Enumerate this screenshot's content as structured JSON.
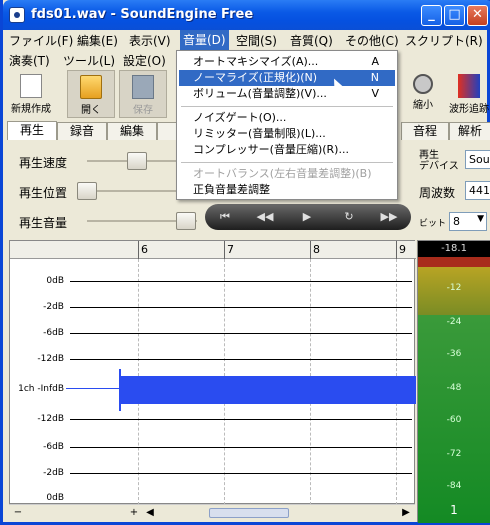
{
  "window": {
    "title": "fds01.wav - SoundEngine Free",
    "minimize_label": "_",
    "maximize_label": "□",
    "close_label": "✕"
  },
  "menubar": {
    "row1": [
      "ファイル(F)",
      "編集(E)",
      "表示(V)",
      "音量(D)",
      "空間(S)",
      "音質(Q)",
      "その他(C)",
      "スクリプト(R)"
    ],
    "row2": [
      "演奏(T)",
      "ツール(L)",
      "設定(O)"
    ],
    "open_menu": "音量(D)"
  },
  "toolbar": {
    "new": "新規作成",
    "open": "開く",
    "save": "保存",
    "reduce": "縮小",
    "wave_tracking": "波形追跡"
  },
  "tabs": [
    "再生",
    "録音",
    "編集",
    "音程",
    "解析"
  ],
  "controls": {
    "speed_label": "再生速度",
    "position_label": "再生位置",
    "volume_label": "再生音量",
    "device_label": "再生\nデバイス",
    "device_value": "Sou",
    "freq_label": "周波数",
    "freq_value": "441",
    "bit_label": "ビット",
    "bit_value": "8",
    "speed_level": 0.45,
    "position_level": 0.0,
    "volume_level": 0.9
  },
  "transport": {
    "rewind_icon": "skip-back-icon",
    "back_icon": "rewind-icon",
    "play_icon": "play-icon",
    "loop_icon": "loop-icon",
    "forward_icon": "fast-forward-icon"
  },
  "waveform": {
    "ruler": [
      "6",
      "7",
      "8",
      "9"
    ],
    "db_labels": [
      "0dB",
      "-2dB",
      "-6dB",
      "-12dB",
      "1ch -InfdB",
      "-12dB",
      "-6dB",
      "-2dB",
      "0dB"
    ]
  },
  "meter": {
    "top_value": "-18.1",
    "scale": [
      "-12",
      "-24",
      "-36",
      "-48",
      "-60",
      "-72",
      "-84"
    ],
    "channel": "1"
  },
  "dropdown": {
    "items": [
      {
        "label": "オートマキシマイズ(A)...",
        "shortcut": "A"
      },
      {
        "label": "ノーマライズ(正規化)(N)",
        "shortcut": "N"
      },
      {
        "label": "ボリューム(音量調整)(V)...",
        "shortcut": "V"
      },
      {
        "label": "ノイズゲート(O)...",
        "shortcut": ""
      },
      {
        "label": "リミッター(音量制限)(L)...",
        "shortcut": ""
      },
      {
        "label": "コンプレッサー(音量圧縮)(R)...",
        "shortcut": ""
      },
      {
        "label": "オートバランス(左右音量差調整)(B)",
        "shortcut": ""
      },
      {
        "label": "正負音量差調整",
        "shortcut": ""
      }
    ],
    "highlighted_index": 1,
    "disabled_index": 6
  },
  "colors": {
    "title_bar": "#0a5ae6",
    "waveform": "#2a4cf0",
    "menu_highlight": "#316ac5"
  }
}
